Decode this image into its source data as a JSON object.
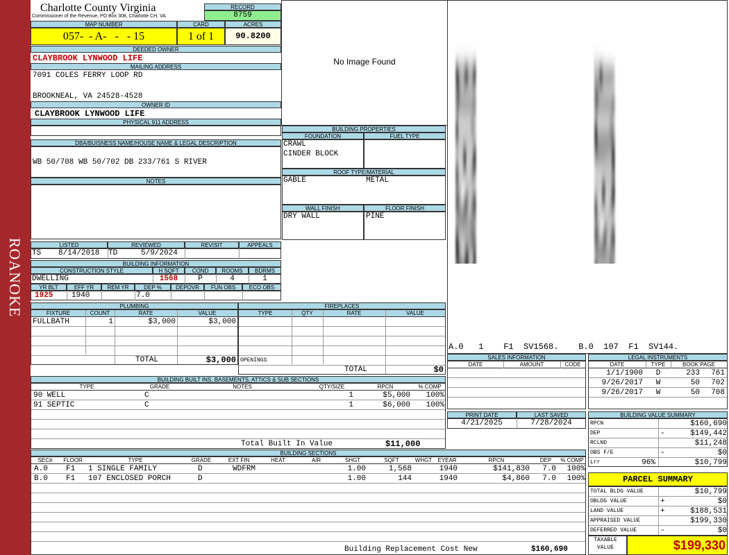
{
  "side_label": "ROANOKE",
  "county": {
    "name": "Charlotte County Virginia",
    "subtitle": "Commissioner of the Revenue, PO Box 308, Charlotte CH, VA"
  },
  "record": {
    "label": "RECORD",
    "value": "8759"
  },
  "map_number": {
    "label": "MAP NUMBER",
    "value": "057-  - A-   -   - 15"
  },
  "card": {
    "label": "CARD",
    "value": "1 of 1"
  },
  "acres": {
    "label": "ACRES",
    "value": "90.8200"
  },
  "deeded_owner": {
    "label": "DEEDED OWNER",
    "value": "CLAYBROOK LYNWOOD LIFE"
  },
  "mailing": {
    "label": "MAILING ADDRESS",
    "line1": "7091 COLES FERRY LOOP RD",
    "line2": "BROOKNEAL, VA 24528-4528"
  },
  "owner_id": {
    "label": "OWNER ID",
    "value": "CLAYBROOK LYNWOOD LIFE"
  },
  "physical_address": {
    "label": "PHYSICAL 911 ADDRESS",
    "value": ""
  },
  "legal": {
    "label": "DBA/BUISNESS NAME/HOUSE NAME & LEGAL DESCRIPTION",
    "value": "WB 50/708 WB 50/702 DB 233/761 S RIVER"
  },
  "notes": {
    "label": "NOTES",
    "value": ""
  },
  "image_placeholder": "No Image Found",
  "sketch": {
    "labels": [
      "B.0 1 F1 SV1568.",
      "A.0 107 F1 SV144."
    ],
    "footer": "A.0   1    F1  SV1568.    B.0  107  F1  SV144."
  },
  "building_properties": {
    "label": "BUILDING PROPERTIES",
    "foundation_label": "FOUNDATION",
    "foundation": [
      "CRAWL",
      "CINDER BLOCK"
    ],
    "fuel_label": "FUEL TYPE",
    "fuel": "",
    "roof_label": "ROOF TYPE/MATERIAL",
    "roof_type": "GABLE",
    "roof_material": "METAL",
    "wall_label": "WALL FINISH",
    "wall": "DRY WALL",
    "floor_label": "FLOOR FINISH",
    "floor": "PINE"
  },
  "listing": {
    "listed_label": "LISTED",
    "listed_by": "TS",
    "listed_date": "8/14/2018",
    "reviewed_label": "REVIEWED",
    "reviewed_by": "TD",
    "reviewed_date": "5/9/2024",
    "revisit_label": "REVISIT",
    "appeals_label": "APPEALS"
  },
  "building_info": {
    "label": "BUILDING INFORMATION",
    "cons_label": "CONSTRUCTION STYLE",
    "cons": "DWELLING",
    "hsqft_label": "H SQFT",
    "hsqft": "1568",
    "cond_label": "COND",
    "cond": "P",
    "rooms_label": "ROOMS",
    "rooms": "4",
    "bdrms_label": "BDRMS",
    "bdrms": "1",
    "yrblt_label": "YR BLT",
    "yrblt": "1925",
    "effyr_label": "EFF YR",
    "effyr": "1940",
    "remyr_label": "REM YR",
    "remyr": "",
    "dep_label": "DEP %",
    "dep": "7.0",
    "depovr_label": "DEPOVR",
    "funobs_label": "FUN OBS",
    "ecoobs_label": "ECO OBS"
  },
  "plumbing": {
    "label": "PLUMBING",
    "headers": [
      "FIXTURE",
      "COUNT",
      "RATE",
      "VALUE"
    ],
    "rows": [
      {
        "fixture": "FULLBATH",
        "count": "1",
        "rate": "$3,000",
        "value": "$3,000"
      }
    ],
    "total_label": "TOTAL",
    "total": "$3,000"
  },
  "fireplaces": {
    "label": "FIREPLACES",
    "headers": [
      "TYPE",
      "QTY",
      "RATE",
      "VALUE"
    ],
    "openings_label": "OPENINGS",
    "total_label": "TOTAL",
    "total": "$0"
  },
  "sales": {
    "label": "SALES INFORMATION",
    "headers": [
      "DATE",
      "AMOUNT",
      "CODE"
    ]
  },
  "legal_instruments": {
    "label": "LEGAL INSTRUMENTS",
    "headers": [
      "DATE",
      "TYPE",
      "BOOK PAGE"
    ],
    "rows": [
      {
        "date": "1/1/1900",
        "type": "D",
        "book": "233",
        "page": "761"
      },
      {
        "date": "9/26/2017",
        "type": "W",
        "book": "50",
        "page": "702"
      },
      {
        "date": "9/26/2017",
        "type": "W",
        "book": "50",
        "page": "708"
      }
    ]
  },
  "built_ins": {
    "label": "BUILDING BUILT INS, BASEMENTS, ATTICS & SUB SECTIONS",
    "headers": [
      "TYPE",
      "GRADE",
      "NOTES",
      "QTY/SIZE",
      "RPCN",
      "% COMP"
    ],
    "rows": [
      {
        "type": "90 WELL",
        "grade": "C",
        "notes": "",
        "qty": "1",
        "rpcn": "$5,000",
        "comp": "100%"
      },
      {
        "type": "91 SEPTIC",
        "grade": "C",
        "notes": "",
        "qty": "1",
        "rpcn": "$6,000",
        "comp": "100%"
      }
    ],
    "total_label": "Total Built In Value",
    "total": "$11,000"
  },
  "print": {
    "print_label": "PRINT DATE",
    "print_date": "4/21/2025",
    "saved_label": "LAST SAVED",
    "saved_date": "7/28/2024"
  },
  "value_summary": {
    "label": "BUILDING VALUE SUMMARY",
    "rows": [
      {
        "label": "RPCN",
        "sign": "",
        "value": "$160,690"
      },
      {
        "label": "DEP",
        "sign": "-",
        "value": "$149,442"
      },
      {
        "label": "RCLND",
        "sign": "",
        "value": "$11,248"
      },
      {
        "label": "OBS F/E",
        "sign": "-",
        "value": "$0"
      },
      {
        "label": "Lrr",
        "pct": "96%",
        "sign": "",
        "value": "$10,799"
      }
    ]
  },
  "building_sections": {
    "label": "BUILDING SECTIONS",
    "headers": [
      "SEC#",
      "FLOOR",
      "TYPE",
      "GRADE",
      "EXT FIN",
      "HEAT",
      "AIR",
      "SHGT",
      "SQFT",
      "WHGT",
      "EYEAR",
      "RPCN",
      "DEP",
      "% COMP"
    ],
    "rows": [
      {
        "sec": "A.0",
        "floor": "F1",
        "type": "1 SINGLE FAMILY",
        "grade": "D",
        "ext": "WDFRM",
        "heat": "",
        "air": "",
        "shgt": "1.00",
        "sqft": "1,568",
        "whgt": "",
        "eyear": "1940",
        "rpcn": "$141,830",
        "dep": "7.0",
        "comp": "100%"
      },
      {
        "sec": "B.0",
        "floor": "F1",
        "type": "107 ENCLOSED PORCH",
        "grade": "D",
        "ext": "",
        "heat": "",
        "air": "",
        "shgt": "1.00",
        "sqft": "144",
        "whgt": "",
        "eyear": "1940",
        "rpcn": "$4,860",
        "dep": "7.0",
        "comp": "100%"
      }
    ],
    "replacement_label": "Building Replacement Cost New",
    "replacement": "$160,690"
  },
  "parcel_summary": {
    "label": "PARCEL SUMMARY",
    "rows": [
      {
        "label": "TOTAL BLDG VALUE",
        "sign": "",
        "value": "$10,799"
      },
      {
        "label": "OBLDG VALUE",
        "sign": "+",
        "value": "$0"
      },
      {
        "label": "LAND VALUE",
        "sign": "+",
        "value": "$188,531"
      },
      {
        "label": "APPRAISED VALUE",
        "sign": "",
        "value": "$199,330"
      },
      {
        "label": "DEFERRED VALUE",
        "sign": "-",
        "value": "$0"
      }
    ],
    "taxable_label": "TAXABLE VALUE",
    "taxable": "$199,330"
  },
  "colors": {
    "side": "#a4282b",
    "header": "#add8e6",
    "yellow": "#ffff00",
    "green": "#90ee90",
    "red": "#c00000"
  }
}
